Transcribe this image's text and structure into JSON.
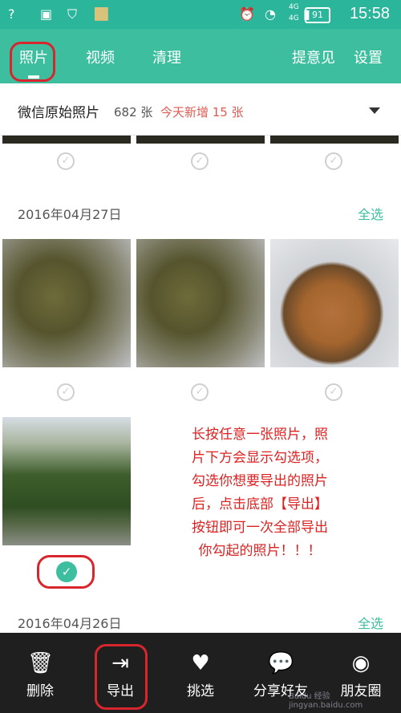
{
  "status_bar": {
    "time": "15:58",
    "battery": "91",
    "network_labels": [
      "4G",
      "4G"
    ],
    "icons": [
      "wifi-question-icon",
      "gallery-icon",
      "shield-icon",
      "bag-icon",
      "alarm-icon",
      "wifi-icon",
      "signal-icon"
    ]
  },
  "tabs": {
    "left": [
      "照片",
      "视频",
      "清理"
    ],
    "right": [
      "提意见",
      "设置"
    ],
    "active": "照片"
  },
  "album": {
    "name": "微信原始照片",
    "count": "682 张",
    "new_today": "今天新增 15 张"
  },
  "sections": [
    {
      "date": "2016年04月27日",
      "select_all": "全选"
    },
    {
      "date": "2016年04月26日",
      "select_all": "全选"
    }
  ],
  "annotation": "长按任意一张照片，照片下方会显示勾选项，勾选你想要导出的照片后，点击底部【导出】按钮即可一次全部导出你勾起的照片！！！",
  "annotation_lines": [
    "长按任意一张照片，照",
    "片下方会显示勾选项，",
    "勾选你想要导出的照片",
    "后，点击底部【导出】",
    "按钮即可一次全部导出",
    "你勾起的照片！！！"
  ],
  "bottom_bar": [
    {
      "label": "删除",
      "icon": "trash-icon"
    },
    {
      "label": "导出",
      "icon": "export-icon"
    },
    {
      "label": "挑选",
      "icon": "heart-icon"
    },
    {
      "label": "分享好友",
      "icon": "wechat-icon"
    },
    {
      "label": "朋友圈",
      "icon": "moments-icon"
    }
  ],
  "watermark": "Baidu 经验 jingyan.baidu.com",
  "colors": {
    "accent": "#3dbf9f",
    "highlight_ring": "#d8262e",
    "bottom_bar": "#1f1f1f"
  }
}
